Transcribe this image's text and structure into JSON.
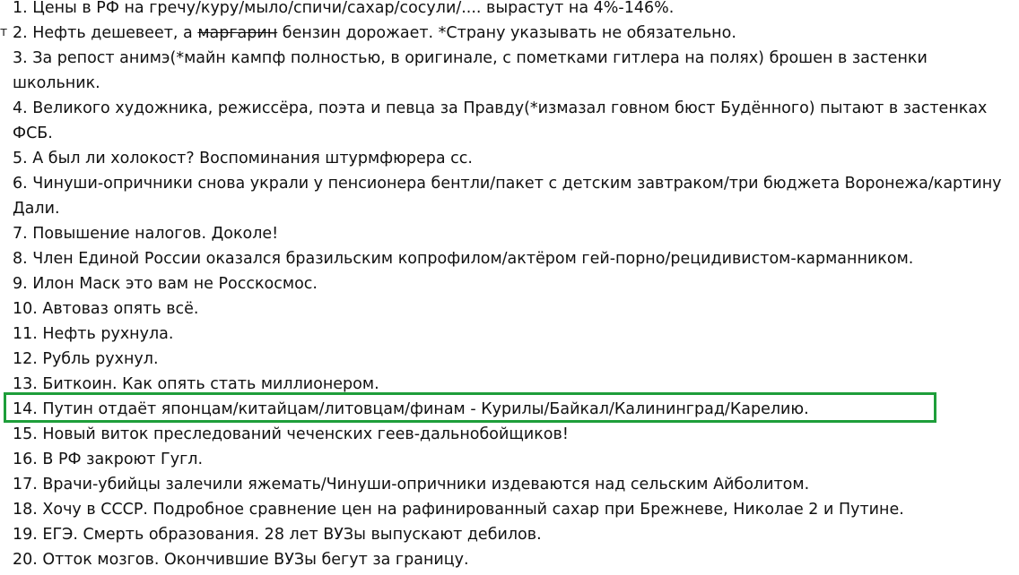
{
  "edge_glyph": "т",
  "items": [
    {
      "text": "1. Цены в РФ на гречу/куру/мыло/спичи/сахар/сосули/.... вырастут на 4%-146%."
    },
    {
      "before": "2. Нефть дешевеет, а ",
      "struck": "маргарин",
      "after": " бензин дорожает. *Страну указывать не обязательно."
    },
    {
      "text": "3. За репост анимэ(*майн кампф полностью, в оригинале, с пометками гитлера на полях) брошен в застенки школьник."
    },
    {
      "text": "4. Великого художника, режиссёра, поэта и певца за Правду(*измазал говном бюст Будённого) пытают в застенках ФСБ."
    },
    {
      "text": "5. А был ли холокост? Воспоминания штурмфюрера сс."
    },
    {
      "text": "6. Чинуши-опричники снова украли у пенсионера бентли/пакет с детским завтраком/три бюджета Воронежа/картину Дали."
    },
    {
      "text": "7. Повышение налогов. Доколе!"
    },
    {
      "text": "8. Член Единой России оказался бразильским копрофилом/актёром гей-порно/рецидивистом-карманником."
    },
    {
      "text": "9. Илон Маск это вам не Росскосмос."
    },
    {
      "text": "10. Автоваз опять всё."
    },
    {
      "text": "11. Нефть рухнула."
    },
    {
      "text": "12. Рубль рухнул."
    },
    {
      "text": "13. Биткоин. Как опять стать миллионером."
    },
    {
      "text": "14. Путин отдаёт японцам/китайцам/литовцам/финам - Курилы/Байкал/Калининград/Карелию."
    },
    {
      "text": "15. Новый виток преследований чеченских геев-дальнобойщиков!"
    },
    {
      "text": "16. В РФ закроют Гугл."
    },
    {
      "text": "17. Врачи-убийцы залечили яжемать/Чинуши-опричники издеваются над сельским Айболитом."
    },
    {
      "text": "18. Хочу в СССР. Подробное сравнение цен на рафинированный сахар при Брежневе, Николае 2 и Путине."
    },
    {
      "text": "19. ЕГЭ. Смерть образования. 28 лет ВУЗы выпускают дебилов."
    },
    {
      "text": "20. Отток мозгов. Окончившие ВУЗы бегут за границу."
    }
  ],
  "highlight": {
    "item_number": 14,
    "color": "#1e9e3a"
  }
}
